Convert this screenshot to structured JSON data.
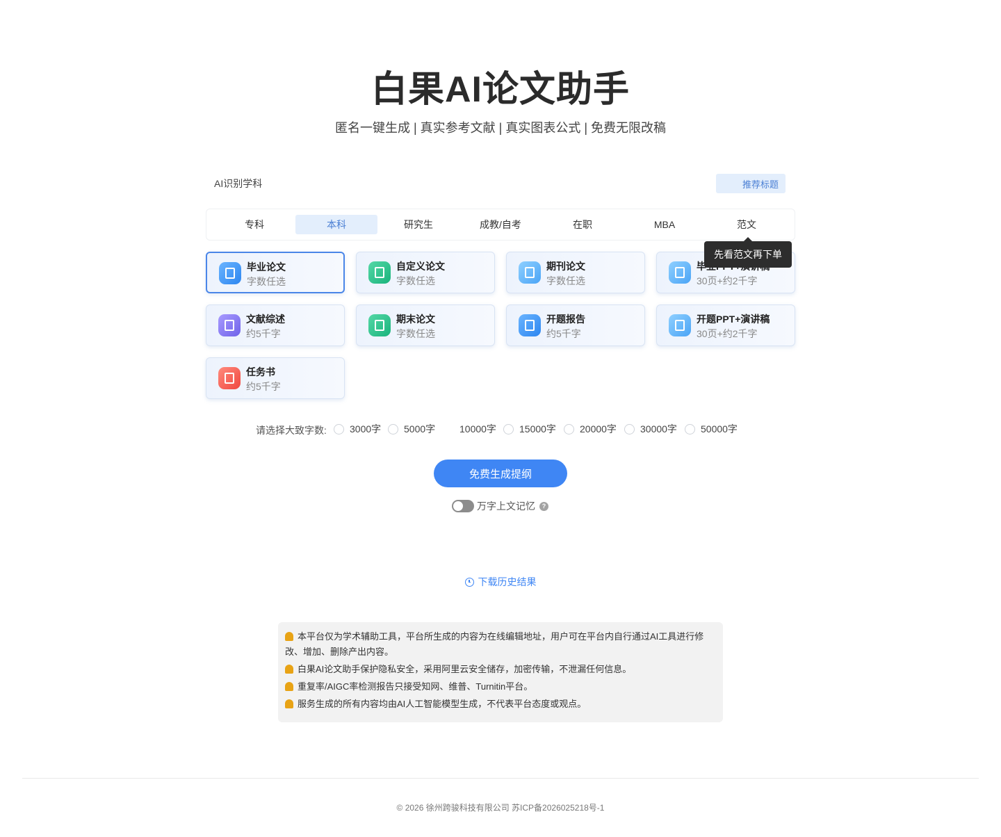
{
  "header": {
    "title": "白果AI论文助手",
    "subtitle": "匿名一键生成 | 真实参考文献 | 真实图表公式 | 免费无限改稿"
  },
  "subject": {
    "label": "AI识别学科",
    "recommend_button": "推荐标题"
  },
  "tabs": [
    {
      "label": "专科",
      "active": false
    },
    {
      "label": "本科",
      "active": true
    },
    {
      "label": "研究生",
      "active": false
    },
    {
      "label": "成教/自考",
      "active": false
    },
    {
      "label": "在职",
      "active": false
    },
    {
      "label": "MBA",
      "active": false
    },
    {
      "label": "范文",
      "active": false
    }
  ],
  "tooltip": "先看范文再下单",
  "cards": [
    {
      "title": "毕业论文",
      "sub": "字数任选",
      "icon": "book-icon",
      "selected": true
    },
    {
      "title": "自定义论文",
      "sub": "字数任选",
      "icon": "pen-icon",
      "selected": false
    },
    {
      "title": "期刊论文",
      "sub": "字数任选",
      "icon": "journal-icon",
      "selected": false
    },
    {
      "title": "毕业PPT+演讲稿",
      "sub": "30页+约2千字",
      "icon": "ppt-icon",
      "selected": false
    },
    {
      "title": "文献综述",
      "sub": "约5千字",
      "icon": "document-icon",
      "selected": false
    },
    {
      "title": "期末论文",
      "sub": "字数任选",
      "icon": "document-icon",
      "selected": false
    },
    {
      "title": "开题报告",
      "sub": "约5千字",
      "icon": "report-icon",
      "selected": false
    },
    {
      "title": "开题PPT+演讲稿",
      "sub": "30页+约2千字",
      "icon": "ppt-icon",
      "selected": false
    },
    {
      "title": "任务书",
      "sub": "约5千字",
      "icon": "task-icon",
      "selected": false
    }
  ],
  "word_count": {
    "label": "请选择大致字数:",
    "options": [
      "3000字",
      "5000字",
      "10000字",
      "15000字",
      "20000字",
      "30000字",
      "50000字"
    ]
  },
  "generate_button": "免费生成提纲",
  "memory": {
    "label": "万字上文记忆",
    "help": "?",
    "enabled": false
  },
  "history_link": "下载历史结果",
  "notices": [
    "本平台仅为学术辅助工具，平台所生成的内容为在线编辑地址，用户可在平台内自行通过AI工具进行修改、增加、删除产出内容。",
    "白果AI论文助手保护隐私安全，采用阿里云安全储存，加密传输，不泄漏任何信息。",
    "重复率/AIGC率检测报告只接受知网、维普、Turnitin平台。",
    "服务生成的所有内容均由AI人工智能模型生成，不代表平台态度或观点。"
  ],
  "footer": "© 2026 徐州跨骏科技有限公司   苏ICP备2026025218号-1"
}
